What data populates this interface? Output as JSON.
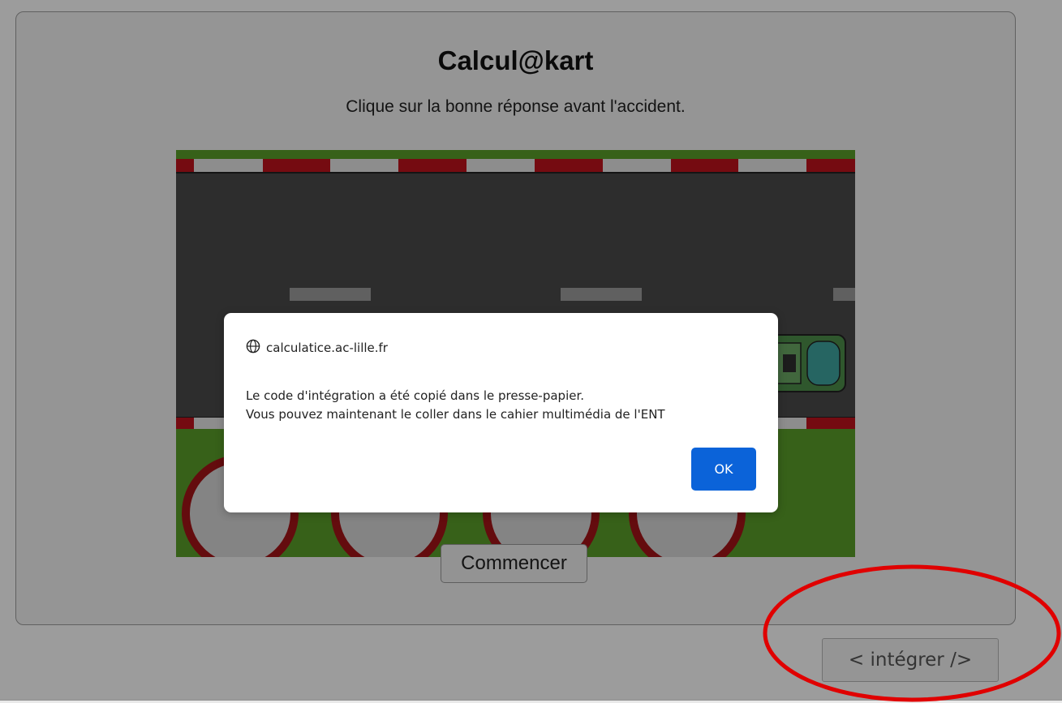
{
  "header": {
    "title": "Calcul@kart",
    "instruction": "Clique sur la bonne réponse avant l'accident."
  },
  "game": {
    "start_label": "Commencer",
    "colors": {
      "road": "#4a4a4a",
      "grass": "#5a9f2a",
      "curb_red": "#c0121c",
      "curb_white": "#e6e6e6",
      "truck": "#4e8f4a",
      "truck_cab": "#3fa6a0"
    }
  },
  "footer": {
    "embed_label": "< intégrer />"
  },
  "dialog": {
    "origin": "calculatice.ac-lille.fr",
    "message_line1": "Le code d'intégration a été copié dans le presse-papier.",
    "message_line2": "Vous pouvez maintenant le coller dans le cahier multimédia de l'ENT",
    "ok_label": "OK",
    "accent": "#0b63d9"
  },
  "annotation": {
    "color": "#e00000",
    "icon": "highlight-ellipse"
  }
}
